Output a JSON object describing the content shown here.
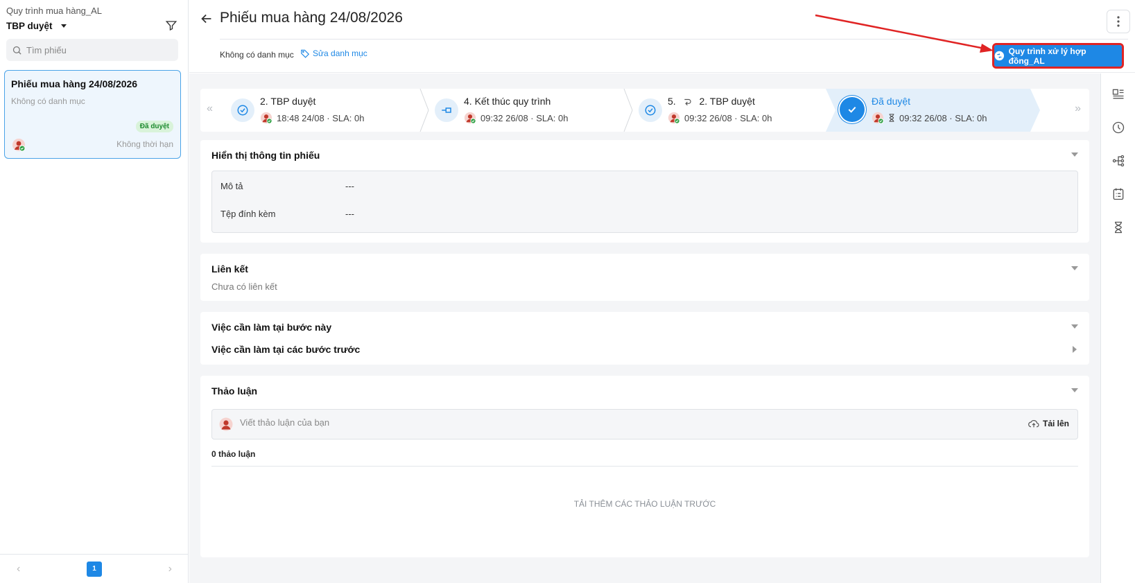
{
  "sidebar": {
    "process_name": "Quy trình mua hàng_AL",
    "current_step": "TBP duyệt",
    "search_placeholder": "Tìm phiếu",
    "ticket": {
      "title": "Phiếu mua hàng 24/08/2026",
      "category": "Không có danh mục",
      "status": "Đã duyệt",
      "deadline": "Không thời hạn"
    },
    "pagination": {
      "current_page": "1"
    }
  },
  "header": {
    "title": "Phiếu mua hàng 24/08/2026",
    "category": "Không có danh mục",
    "edit_category": "Sửa danh mục",
    "process_button": "Quy trình xử lý hợp đồng_AL"
  },
  "stepper": {
    "steps": [
      {
        "prefix": "",
        "title": "2. TBP duyệt",
        "meta": "18:48 24/08 · SLA: 0h",
        "icon": "check-circle-icon"
      },
      {
        "prefix": "",
        "title": "4. Kết thúc quy trình",
        "meta": "09:32 26/08 · SLA: 0h",
        "icon": "end-node-icon"
      },
      {
        "prefix": "5.",
        "title": "2. TBP duyệt",
        "meta": "09:32 26/08 · SLA: 0h",
        "icon": "check-circle-icon"
      },
      {
        "prefix": "",
        "title": "Đã duyệt",
        "meta": "09:32 26/08 · SLA: 0h",
        "icon": "check-icon"
      }
    ]
  },
  "info_section": {
    "title": "Hiển thị thông tin phiếu",
    "fields": [
      {
        "label": "Mô tả",
        "value": "---"
      },
      {
        "label": "Tệp đính kèm",
        "value": "---"
      }
    ]
  },
  "links_section": {
    "title": "Liên kết",
    "empty": "Chưa có liên kết"
  },
  "tasks_section": {
    "current_title": "Việc cần làm tại bước này",
    "previous_title": "Việc cần làm tại các bước trước"
  },
  "discussion_section": {
    "title": "Thảo luận",
    "placeholder": "Viết thảo luận của bạn",
    "upload": "Tải lên",
    "count": "0 thảo luận",
    "load_more": "TẢI THÊM CÁC THẢO LUẬN TRƯỚC"
  },
  "colors": {
    "accent": "#1e88e5",
    "annotation": "#e02424",
    "success": "#1c8a2e"
  },
  "right_rail_icons": [
    "detail-panel-icon",
    "clock-icon",
    "flow-icon",
    "checklist-icon",
    "hourglass-icon"
  ]
}
